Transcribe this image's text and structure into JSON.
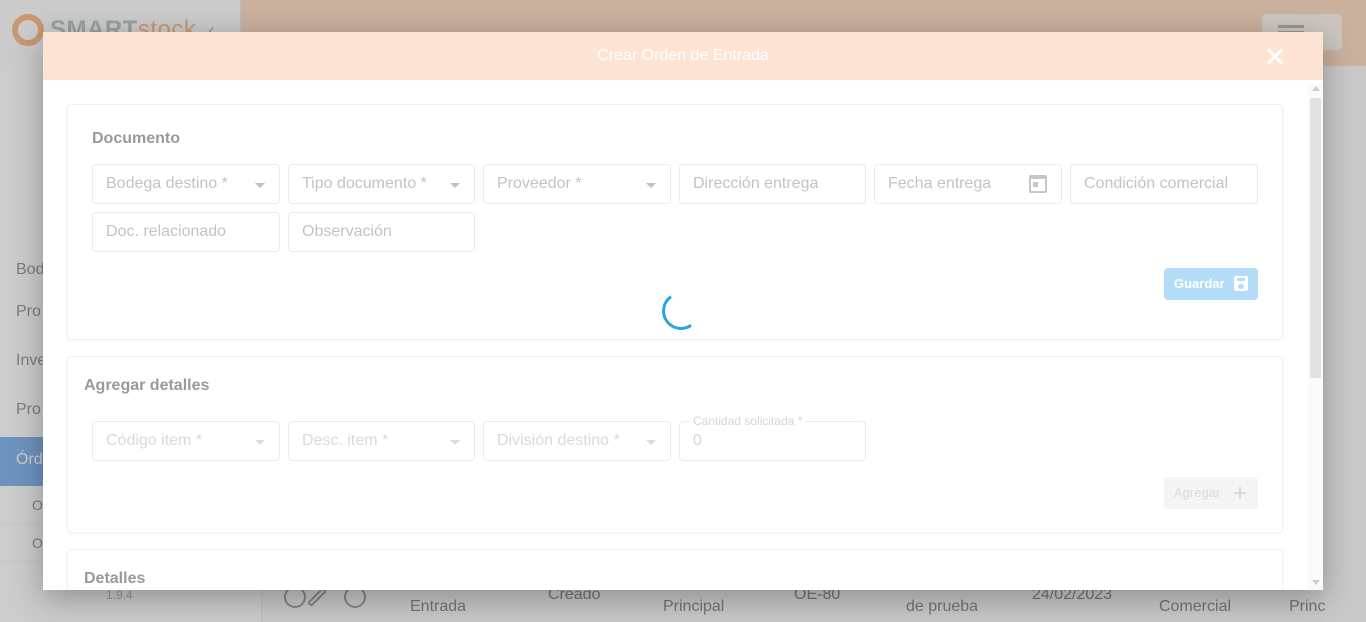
{
  "app": {
    "logo_primary": "SMART",
    "logo_accent": "stock",
    "version": "1.9.4"
  },
  "sidebar": {
    "items": [
      {
        "label": "Bod"
      },
      {
        "label": "Pro"
      },
      {
        "label": "Inve"
      },
      {
        "label": "Pro"
      },
      {
        "label": "Órd"
      }
    ],
    "subitems": [
      {
        "label": "Or"
      },
      {
        "label": "Or"
      }
    ]
  },
  "background_row": {
    "type": "Entrada",
    "status": "Creado",
    "warehouse": "Principal",
    "code": "OE-80",
    "supplier": "de prueba",
    "date": "24/02/2023",
    "condition": "Comercial",
    "extra": "Princ"
  },
  "modal": {
    "title": "Crear Orden de Entrada",
    "documento": {
      "title": "Documento",
      "bodega_destino": "Bodega destino *",
      "tipo_documento": "Tipo documento *",
      "proveedor": "Proveedor *",
      "direccion_entrega": "Dirección entrega",
      "fecha_entrega": "Fecha entrega",
      "condicion_comercial": "Condición comercial",
      "doc_relacionado": "Doc. relacionado",
      "observacion": "Observación",
      "save_label": "Guardar"
    },
    "agregar_detalles": {
      "title": "Agregar detalles",
      "codigo_item": "Código item *",
      "desc_item": "Desc. item *",
      "division_destino": "División destino *",
      "cantidad_label": "Cantidad solicitada *",
      "cantidad_value": "0",
      "add_label": "Agregar"
    },
    "detalles": {
      "title": "Detalles"
    }
  }
}
